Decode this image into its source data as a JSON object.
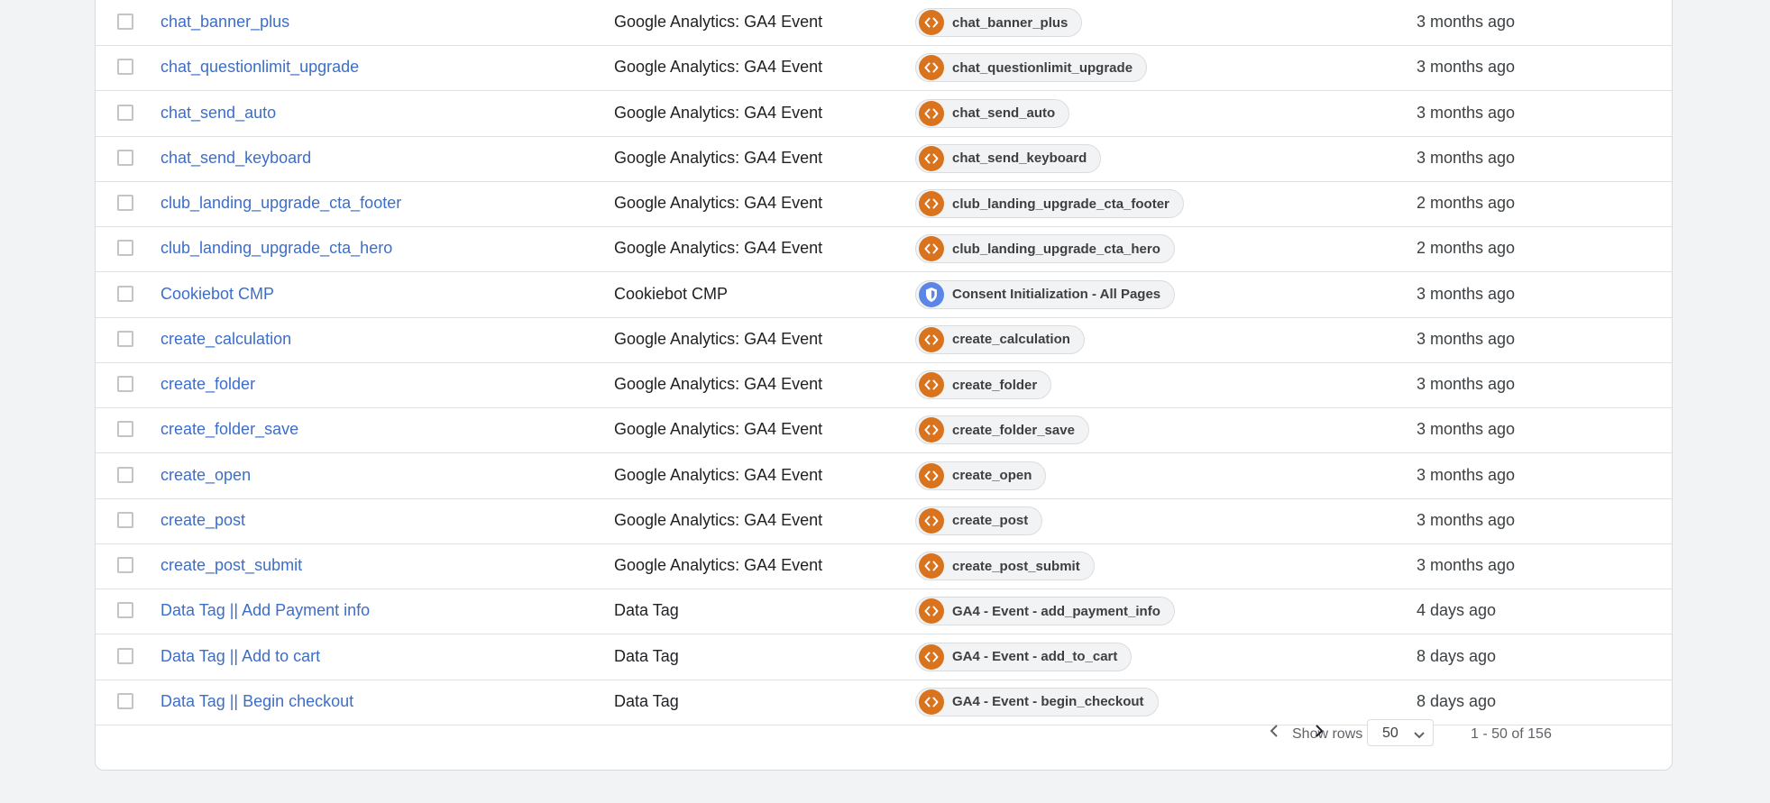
{
  "rows": [
    {
      "name": "chat_banner_plus",
      "type": "Google Analytics: GA4 Event",
      "trigger_icon": "code-icon",
      "trigger": "chat_banner_plus",
      "modified": "3 months ago"
    },
    {
      "name": "chat_questionlimit_upgrade",
      "type": "Google Analytics: GA4 Event",
      "trigger_icon": "code-icon",
      "trigger": "chat_questionlimit_upgrade",
      "modified": "3 months ago"
    },
    {
      "name": "chat_send_auto",
      "type": "Google Analytics: GA4 Event",
      "trigger_icon": "code-icon",
      "trigger": "chat_send_auto",
      "modified": "3 months ago"
    },
    {
      "name": "chat_send_keyboard",
      "type": "Google Analytics: GA4 Event",
      "trigger_icon": "code-icon",
      "trigger": "chat_send_keyboard",
      "modified": "3 months ago"
    },
    {
      "name": "club_landing_upgrade_cta_footer",
      "type": "Google Analytics: GA4 Event",
      "trigger_icon": "code-icon",
      "trigger": "club_landing_upgrade_cta_footer",
      "modified": "2 months ago"
    },
    {
      "name": "club_landing_upgrade_cta_hero",
      "type": "Google Analytics: GA4 Event",
      "trigger_icon": "code-icon",
      "trigger": "club_landing_upgrade_cta_hero",
      "modified": "2 months ago"
    },
    {
      "name": "Cookiebot CMP",
      "type": "Cookiebot CMP",
      "trigger_icon": "shield-icon",
      "trigger": "Consent Initialization - All Pages",
      "modified": "3 months ago"
    },
    {
      "name": "create_calculation",
      "type": "Google Analytics: GA4 Event",
      "trigger_icon": "code-icon",
      "trigger": "create_calculation",
      "modified": "3 months ago"
    },
    {
      "name": "create_folder",
      "type": "Google Analytics: GA4 Event",
      "trigger_icon": "code-icon",
      "trigger": "create_folder",
      "modified": "3 months ago"
    },
    {
      "name": "create_folder_save",
      "type": "Google Analytics: GA4 Event",
      "trigger_icon": "code-icon",
      "trigger": "create_folder_save",
      "modified": "3 months ago"
    },
    {
      "name": "create_open",
      "type": "Google Analytics: GA4 Event",
      "trigger_icon": "code-icon",
      "trigger": "create_open",
      "modified": "3 months ago"
    },
    {
      "name": "create_post",
      "type": "Google Analytics: GA4 Event",
      "trigger_icon": "code-icon",
      "trigger": "create_post",
      "modified": "3 months ago"
    },
    {
      "name": "create_post_submit",
      "type": "Google Analytics: GA4 Event",
      "trigger_icon": "code-icon",
      "trigger": "create_post_submit",
      "modified": "3 months ago"
    },
    {
      "name": "Data Tag || Add Payment info",
      "type": "Data Tag",
      "trigger_icon": "code-icon",
      "trigger": "GA4 - Event - add_payment_info",
      "modified": "4 days ago"
    },
    {
      "name": "Data Tag || Add to cart",
      "type": "Data Tag",
      "trigger_icon": "code-icon",
      "trigger": "GA4 - Event - add_to_cart",
      "modified": "8 days ago"
    },
    {
      "name": "Data Tag || Begin checkout",
      "type": "Data Tag",
      "trigger_icon": "code-icon",
      "trigger": "GA4 - Event - begin_checkout",
      "modified": "8 days ago"
    }
  ],
  "pagination": {
    "show_rows_label": "Show rows",
    "rows_per_page": "50",
    "range_label": "1 - 50 of 156"
  },
  "colors": {
    "link": "#3c6ec9",
    "code_trigger": "#d9731e",
    "consent_trigger": "#5b86e5"
  }
}
